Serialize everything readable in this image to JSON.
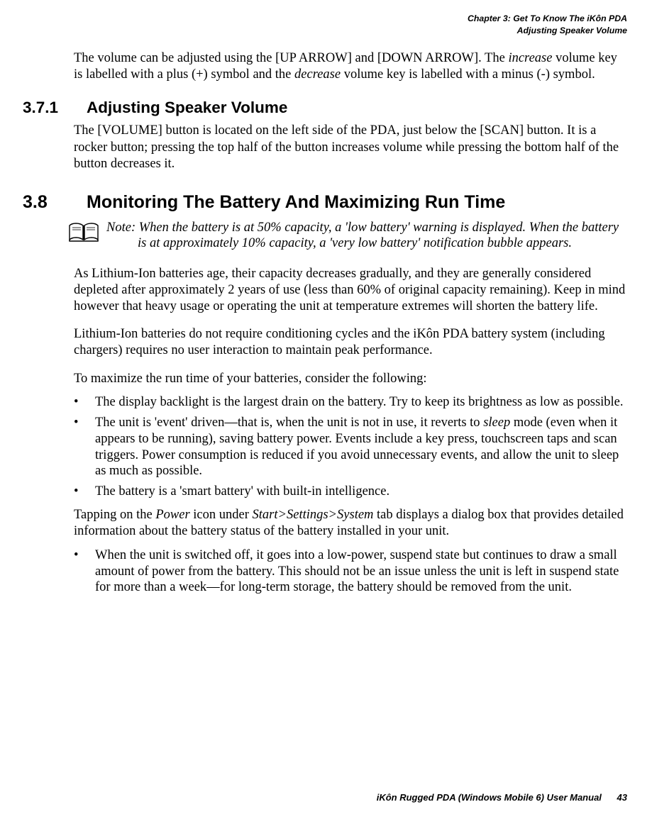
{
  "header": {
    "chapter_line": "Chapter 3: Get To Know The iKôn PDA",
    "section_line": "Adjusting Speaker Volume"
  },
  "intro_para_parts": {
    "p1": "The volume can be adjusted using the [UP ARROW] and [DOWN ARROW]. The ",
    "p2": "increase",
    "p3": " volume key is labelled with a plus (+) symbol and the ",
    "p4": "decrease",
    "p5": " volume key is labelled with a minus (-) symbol."
  },
  "s371": {
    "num": "3.7.1",
    "title": "Adjusting Speaker Volume",
    "para": "The [VOLUME] button is located on the left side of the PDA, just below the [SCAN] button. It is a rocker button; pressing the top half of the button increases volume while pressing the bottom half of the button decreases it."
  },
  "s38": {
    "num": "3.8",
    "title": "Monitoring The Battery And Maximizing Run Time"
  },
  "note": {
    "label": "Note:",
    "text": " When the battery is at 50% capacity, a 'low battery' warning is displayed. When the battery is at approximately 10% capacity, a 'very low battery' notification bubble appears."
  },
  "body_paras": {
    "age": "As Lithium-Ion batteries age, their capacity decreases gradually, and they are generally considered depleted after approximately 2 years of use (less than 60% of original capacity remaining). Keep in mind however that heavy usage or operating the unit at temperature extremes will shorten the battery life.",
    "cond": "Lithium-Ion batteries do not require conditioning cycles and the iKôn PDA battery system (including chargers) requires no user interaction to maintain peak performance.",
    "max": "To maximize the run time of your batteries, consider the following:"
  },
  "bullets1": {
    "b1": "The display backlight is the largest drain on the battery. Try to keep its brightness as low as possible.",
    "b2_parts": {
      "a": "The unit is 'event' driven—that is, when the unit is not in use, it reverts to ",
      "b": "sleep",
      "c": " mode (even when it appears to be running), saving battery power. Events include a key press, touchscreen taps and scan triggers. Power consumption is reduced if you avoid unnecessary events, and allow the unit to sleep as much as possible."
    },
    "b3": "The battery is a 'smart battery' with built-in intelligence."
  },
  "power_para_parts": {
    "a": "Tapping on the ",
    "b": "Power",
    "c": " icon under ",
    "d": "Start>Settings>System",
    "e": " tab displays a dialog box that provides detailed information about the battery status of the battery installed in your unit."
  },
  "bullets2": {
    "b1": "When the unit is switched off, it goes into a low-power, suspend state but continues to draw a small amount of power from the battery. This should not be an issue unless the unit is left in suspend state for more than a week—for long-term storage, the battery should be removed from the unit."
  },
  "footer": {
    "doc": "iKôn Rugged PDA (Windows Mobile 6) User Manual",
    "page": "43"
  }
}
